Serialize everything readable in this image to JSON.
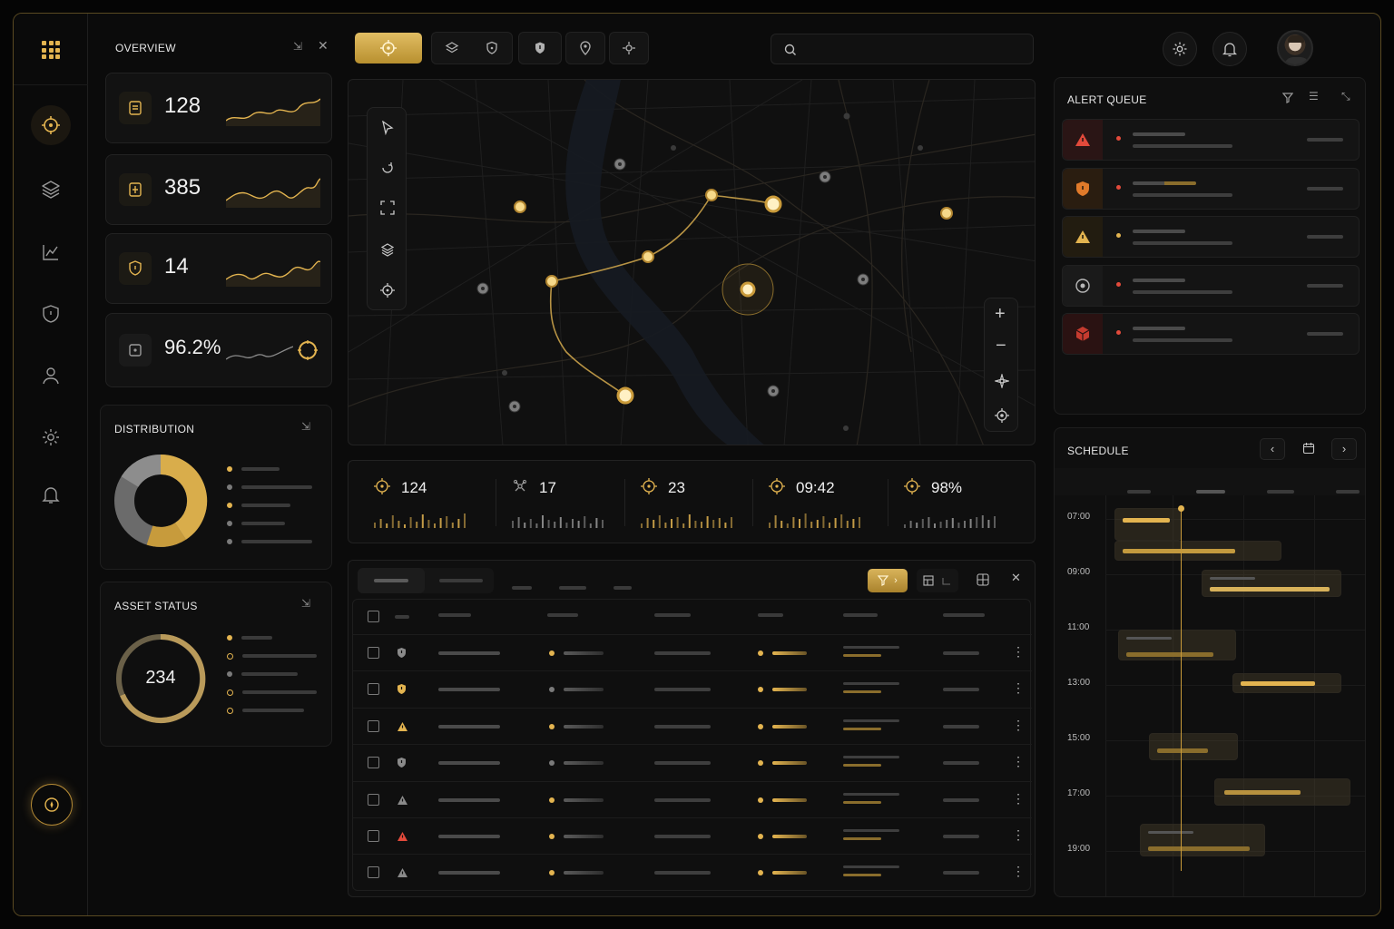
{
  "colors": {
    "accent": "#e3b450",
    "alert_red": "#e24a3b",
    "warn": "#e3b450",
    "bg": "#0b0b0b"
  },
  "overview": {
    "title": "OVERVIEW",
    "stats": [
      {
        "icon": "badge-icon",
        "value": "128"
      },
      {
        "icon": "document-badge-icon",
        "value": "385"
      },
      {
        "icon": "shield-icon",
        "value": "14"
      },
      {
        "icon": "target-box-icon",
        "value": "96.2%"
      }
    ]
  },
  "distribution": {
    "title": "DISTRIBUTION"
  },
  "asset_status": {
    "title": "ASSET STATUS",
    "value": "234"
  },
  "metrics": [
    {
      "icon": "crosshair-icon",
      "value": "124"
    },
    {
      "icon": "drone-icon",
      "value": "17"
    },
    {
      "icon": "crosshair-icon",
      "value": "23"
    },
    {
      "icon": "crosshair-icon",
      "value": "09:42"
    },
    {
      "icon": "crosshair-icon",
      "value": "98%"
    }
  ],
  "alert_queue": {
    "title": "ALERT QUEUE"
  },
  "schedule": {
    "title": "SCHEDULE",
    "times": [
      "07:00",
      "09:00",
      "11:00",
      "13:00",
      "15:00",
      "17:00",
      "19:00"
    ]
  },
  "search": {
    "placeholder": ""
  }
}
